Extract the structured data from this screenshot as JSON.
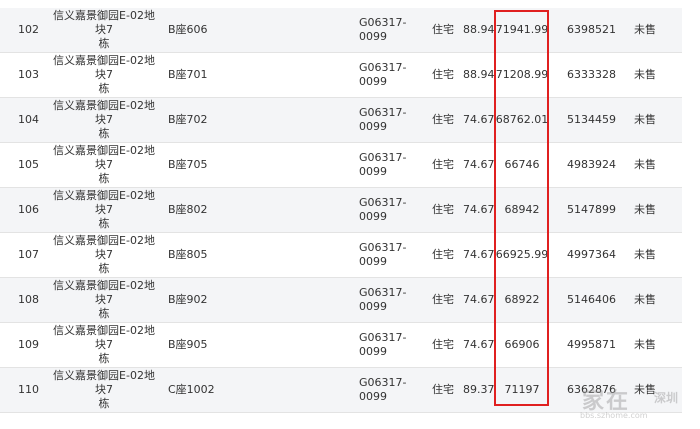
{
  "rows": [
    {
      "idx": "102",
      "project": [
        "信义嘉景御园E-02地块7",
        "栋"
      ],
      "room": "B座606",
      "permit": "G06317-0099",
      "use": "住宅",
      "area": "88.94",
      "price": "71941.99",
      "total": "6398521",
      "status": "未售"
    },
    {
      "idx": "103",
      "project": [
        "信义嘉景御园E-02地块7",
        "栋"
      ],
      "room": "B座701",
      "permit": "G06317-0099",
      "use": "住宅",
      "area": "88.94",
      "price": "71208.99",
      "total": "6333328",
      "status": "未售"
    },
    {
      "idx": "104",
      "project": [
        "信义嘉景御园E-02地块7",
        "栋"
      ],
      "room": "B座702",
      "permit": "G06317-0099",
      "use": "住宅",
      "area": "74.67",
      "price": "68762.01",
      "total": "5134459",
      "status": "未售"
    },
    {
      "idx": "105",
      "project": [
        "信义嘉景御园E-02地块7",
        "栋"
      ],
      "room": "B座705",
      "permit": "G06317-0099",
      "use": "住宅",
      "area": "74.67",
      "price": "66746",
      "total": "4983924",
      "status": "未售"
    },
    {
      "idx": "106",
      "project": [
        "信义嘉景御园E-02地块7",
        "栋"
      ],
      "room": "B座802",
      "permit": "G06317-0099",
      "use": "住宅",
      "area": "74.67",
      "price": "68942",
      "total": "5147899",
      "status": "未售"
    },
    {
      "idx": "107",
      "project": [
        "信义嘉景御园E-02地块7",
        "栋"
      ],
      "room": "B座805",
      "permit": "G06317-0099",
      "use": "住宅",
      "area": "74.67",
      "price": "66925.99",
      "total": "4997364",
      "status": "未售"
    },
    {
      "idx": "108",
      "project": [
        "信义嘉景御园E-02地块7",
        "栋"
      ],
      "room": "B座902",
      "permit": "G06317-0099",
      "use": "住宅",
      "area": "74.67",
      "price": "68922",
      "total": "5146406",
      "status": "未售"
    },
    {
      "idx": "109",
      "project": [
        "信义嘉景御园E-02地块7",
        "栋"
      ],
      "room": "B座905",
      "permit": "G06317-0099",
      "use": "住宅",
      "area": "74.67",
      "price": "66906",
      "total": "4995871",
      "status": "未售"
    },
    {
      "idx": "110",
      "project": [
        "信义嘉景御园E-02地块7",
        "栋"
      ],
      "room": "C座1002",
      "permit": "G06317-0099",
      "use": "住宅",
      "area": "89.37",
      "price": "71197",
      "total": "6362876",
      "status": "未售"
    }
  ],
  "watermark": {
    "main": "家在",
    "city": "深圳",
    "sub": "bbs.szhome.com"
  },
  "colors": {
    "highlight": "#e02020",
    "stripe": "#f4f5f7",
    "border": "#e3e3e3"
  }
}
